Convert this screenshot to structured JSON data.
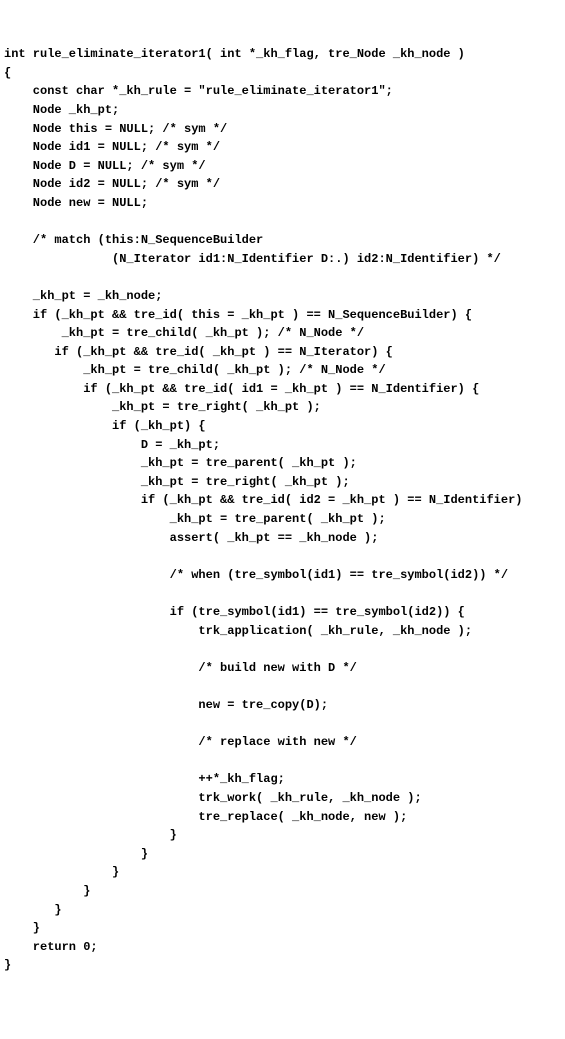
{
  "code": {
    "lines": [
      "int rule_eliminate_iterator1( int *_kh_flag, tre_Node _kh_node )",
      "{",
      "    const char *_kh_rule = \"rule_eliminate_iterator1\";",
      "    Node _kh_pt;",
      "    Node this = NULL; /* sym */",
      "    Node id1 = NULL; /* sym */",
      "    Node D = NULL; /* sym */",
      "    Node id2 = NULL; /* sym */",
      "    Node new = NULL;",
      "",
      "    /* match (this:N_SequenceBuilder",
      "               (N_Iterator id1:N_Identifier D:.) id2:N_Identifier) */",
      "",
      "    _kh_pt = _kh_node;",
      "    if (_kh_pt && tre_id( this = _kh_pt ) == N_SequenceBuilder) {",
      "        _kh_pt = tre_child( _kh_pt ); /* N_Node */",
      "       if (_kh_pt && tre_id( _kh_pt ) == N_Iterator) {",
      "           _kh_pt = tre_child( _kh_pt ); /* N_Node */",
      "           if (_kh_pt && tre_id( id1 = _kh_pt ) == N_Identifier) {",
      "               _kh_pt = tre_right( _kh_pt );",
      "               if (_kh_pt) {",
      "                   D = _kh_pt;",
      "                   _kh_pt = tre_parent( _kh_pt );",
      "                   _kh_pt = tre_right( _kh_pt );",
      "                   if (_kh_pt && tre_id( id2 = _kh_pt ) == N_Identifier)",
      "                       _kh_pt = tre_parent( _kh_pt );",
      "                       assert( _kh_pt == _kh_node );",
      "",
      "                       /* when (tre_symbol(id1) == tre_symbol(id2)) */",
      "",
      "                       if (tre_symbol(id1) == tre_symbol(id2)) {",
      "                           trk_application( _kh_rule, _kh_node );",
      "",
      "                           /* build new with D */",
      "",
      "                           new = tre_copy(D);",
      "",
      "                           /* replace with new */",
      "",
      "                           ++*_kh_flag;",
      "                           trk_work( _kh_rule, _kh_node );",
      "                           tre_replace( _kh_node, new );",
      "                       }",
      "                   }",
      "               }",
      "           }",
      "       }",
      "    }",
      "    return 0;",
      "}"
    ]
  }
}
